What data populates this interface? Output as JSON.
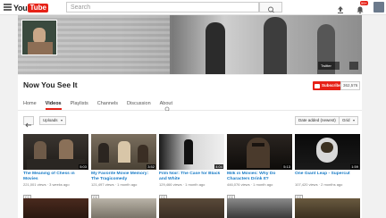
{
  "topbar": {
    "logo_you": "You",
    "logo_tube": "Tube",
    "search_placeholder": "Search",
    "notification_count": "99+"
  },
  "channel": {
    "name": "Now You See It",
    "subscribe_label": "Subscribe",
    "subscriber_count": "362,576",
    "social_link": "Twitter"
  },
  "tabs": [
    "Home",
    "Videos",
    "Playlists",
    "Channels",
    "Discussion",
    "About"
  ],
  "active_tab": "Videos",
  "controls": {
    "uploads_label": "Uploads",
    "sort_label": "Date added (newest)",
    "view_label": "Grid"
  },
  "videos": [
    {
      "title": "The Meaning of Chess in Movies",
      "views": "221,001 views",
      "age": "3 weeks ago",
      "duration": "5:03",
      "cc": "CC"
    },
    {
      "title": "My Favorite Movie Memory: The Tragicomedy",
      "views": "121,497 views",
      "age": "1 month ago",
      "duration": "3:52",
      "cc": "CC"
    },
    {
      "title": "Film Noir: The Case for Black and White",
      "views": "129,466 views",
      "age": "1 month ago",
      "duration": "4:04",
      "cc": "CC"
    },
    {
      "title": "Milk in Movies: Why Do Characters Drink It?",
      "views": "446,076 views",
      "age": "1 month ago",
      "duration": "5:13",
      "cc": "CC"
    },
    {
      "title": "One Giant Leap - Supercut",
      "views": "107,420 views",
      "age": "2 months ago",
      "duration": "1:59",
      "cc": "CC"
    }
  ],
  "colors": {
    "brand_red": "#e62117",
    "link_blue": "#167ac6"
  }
}
